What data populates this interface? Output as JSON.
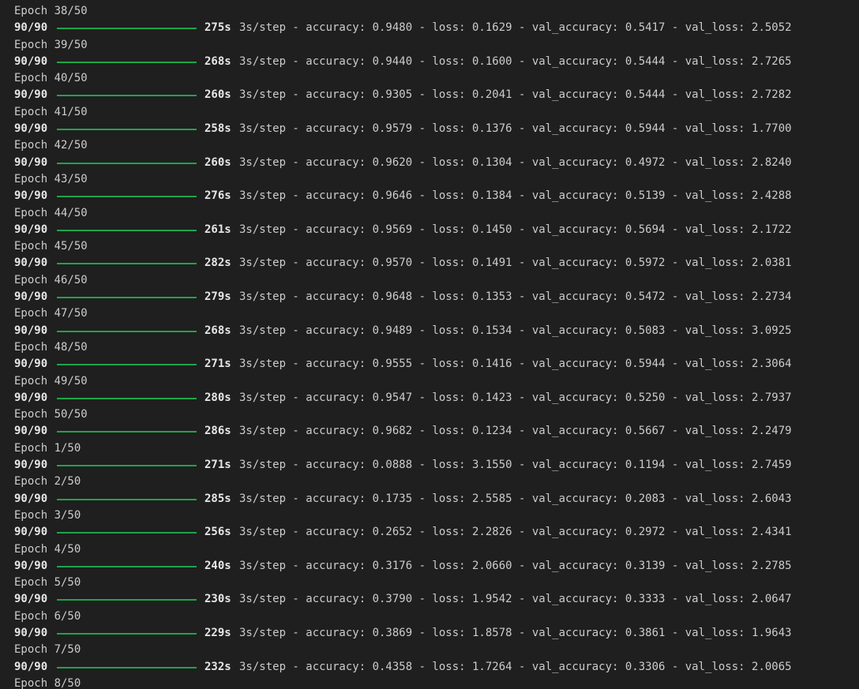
{
  "log": [
    {
      "epoch": "Epoch 38/50",
      "steps": "90/90",
      "time": "275s",
      "metrics": "3s/step - accuracy: 0.9480 - loss: 0.1629 - val_accuracy: 0.5417 - val_loss: 2.5052"
    },
    {
      "epoch": "Epoch 39/50",
      "steps": "90/90",
      "time": "268s",
      "metrics": "3s/step - accuracy: 0.9440 - loss: 0.1600 - val_accuracy: 0.5444 - val_loss: 2.7265"
    },
    {
      "epoch": "Epoch 40/50",
      "steps": "90/90",
      "time": "260s",
      "metrics": "3s/step - accuracy: 0.9305 - loss: 0.2041 - val_accuracy: 0.5444 - val_loss: 2.7282"
    },
    {
      "epoch": "Epoch 41/50",
      "steps": "90/90",
      "time": "258s",
      "metrics": "3s/step - accuracy: 0.9579 - loss: 0.1376 - val_accuracy: 0.5944 - val_loss: 1.7700"
    },
    {
      "epoch": "Epoch 42/50",
      "steps": "90/90",
      "time": "260s",
      "metrics": "3s/step - accuracy: 0.9620 - loss: 0.1304 - val_accuracy: 0.4972 - val_loss: 2.8240"
    },
    {
      "epoch": "Epoch 43/50",
      "steps": "90/90",
      "time": "276s",
      "metrics": "3s/step - accuracy: 0.9646 - loss: 0.1384 - val_accuracy: 0.5139 - val_loss: 2.4288"
    },
    {
      "epoch": "Epoch 44/50",
      "steps": "90/90",
      "time": "261s",
      "metrics": "3s/step - accuracy: 0.9569 - loss: 0.1450 - val_accuracy: 0.5694 - val_loss: 2.1722"
    },
    {
      "epoch": "Epoch 45/50",
      "steps": "90/90",
      "time": "282s",
      "metrics": "3s/step - accuracy: 0.9570 - loss: 0.1491 - val_accuracy: 0.5972 - val_loss: 2.0381"
    },
    {
      "epoch": "Epoch 46/50",
      "steps": "90/90",
      "time": "279s",
      "metrics": "3s/step - accuracy: 0.9648 - loss: 0.1353 - val_accuracy: 0.5472 - val_loss: 2.2734"
    },
    {
      "epoch": "Epoch 47/50",
      "steps": "90/90",
      "time": "268s",
      "metrics": "3s/step - accuracy: 0.9489 - loss: 0.1534 - val_accuracy: 0.5083 - val_loss: 3.0925"
    },
    {
      "epoch": "Epoch 48/50",
      "steps": "90/90",
      "time": "271s",
      "metrics": "3s/step - accuracy: 0.9555 - loss: 0.1416 - val_accuracy: 0.5944 - val_loss: 2.3064"
    },
    {
      "epoch": "Epoch 49/50",
      "steps": "90/90",
      "time": "280s",
      "metrics": "3s/step - accuracy: 0.9547 - loss: 0.1423 - val_accuracy: 0.5250 - val_loss: 2.7937"
    },
    {
      "epoch": "Epoch 50/50",
      "steps": "90/90",
      "time": "286s",
      "metrics": "3s/step - accuracy: 0.9682 - loss: 0.1234 - val_accuracy: 0.5667 - val_loss: 2.2479"
    },
    {
      "epoch": "Epoch 1/50",
      "steps": "90/90",
      "time": "271s",
      "metrics": "3s/step - accuracy: 0.0888 - loss: 3.1550 - val_accuracy: 0.1194 - val_loss: 2.7459"
    },
    {
      "epoch": "Epoch 2/50",
      "steps": "90/90",
      "time": "285s",
      "metrics": "3s/step - accuracy: 0.1735 - loss: 2.5585 - val_accuracy: 0.2083 - val_loss: 2.6043"
    },
    {
      "epoch": "Epoch 3/50",
      "steps": "90/90",
      "time": "256s",
      "metrics": "3s/step - accuracy: 0.2652 - loss: 2.2826 - val_accuracy: 0.2972 - val_loss: 2.4341"
    },
    {
      "epoch": "Epoch 4/50",
      "steps": "90/90",
      "time": "240s",
      "metrics": "3s/step - accuracy: 0.3176 - loss: 2.0660 - val_accuracy: 0.3139 - val_loss: 2.2785"
    },
    {
      "epoch": "Epoch 5/50",
      "steps": "90/90",
      "time": "230s",
      "metrics": "3s/step - accuracy: 0.3790 - loss: 1.9542 - val_accuracy: 0.3333 - val_loss: 2.0647"
    },
    {
      "epoch": "Epoch 6/50",
      "steps": "90/90",
      "time": "229s",
      "metrics": "3s/step - accuracy: 0.3869 - loss: 1.8578 - val_accuracy: 0.3861 - val_loss: 1.9643"
    },
    {
      "epoch": "Epoch 7/50",
      "steps": "90/90",
      "time": "232s",
      "metrics": "3s/step - accuracy: 0.4358 - loss: 1.7264 - val_accuracy: 0.3306 - val_loss: 2.0065"
    }
  ],
  "trailing_epoch": "Epoch 8/50",
  "colors": {
    "background": "#1f1f1f",
    "text": "#cccccc",
    "progress_bar": "#1ea44a"
  },
  "progress_bar_fraction": 1.0
}
